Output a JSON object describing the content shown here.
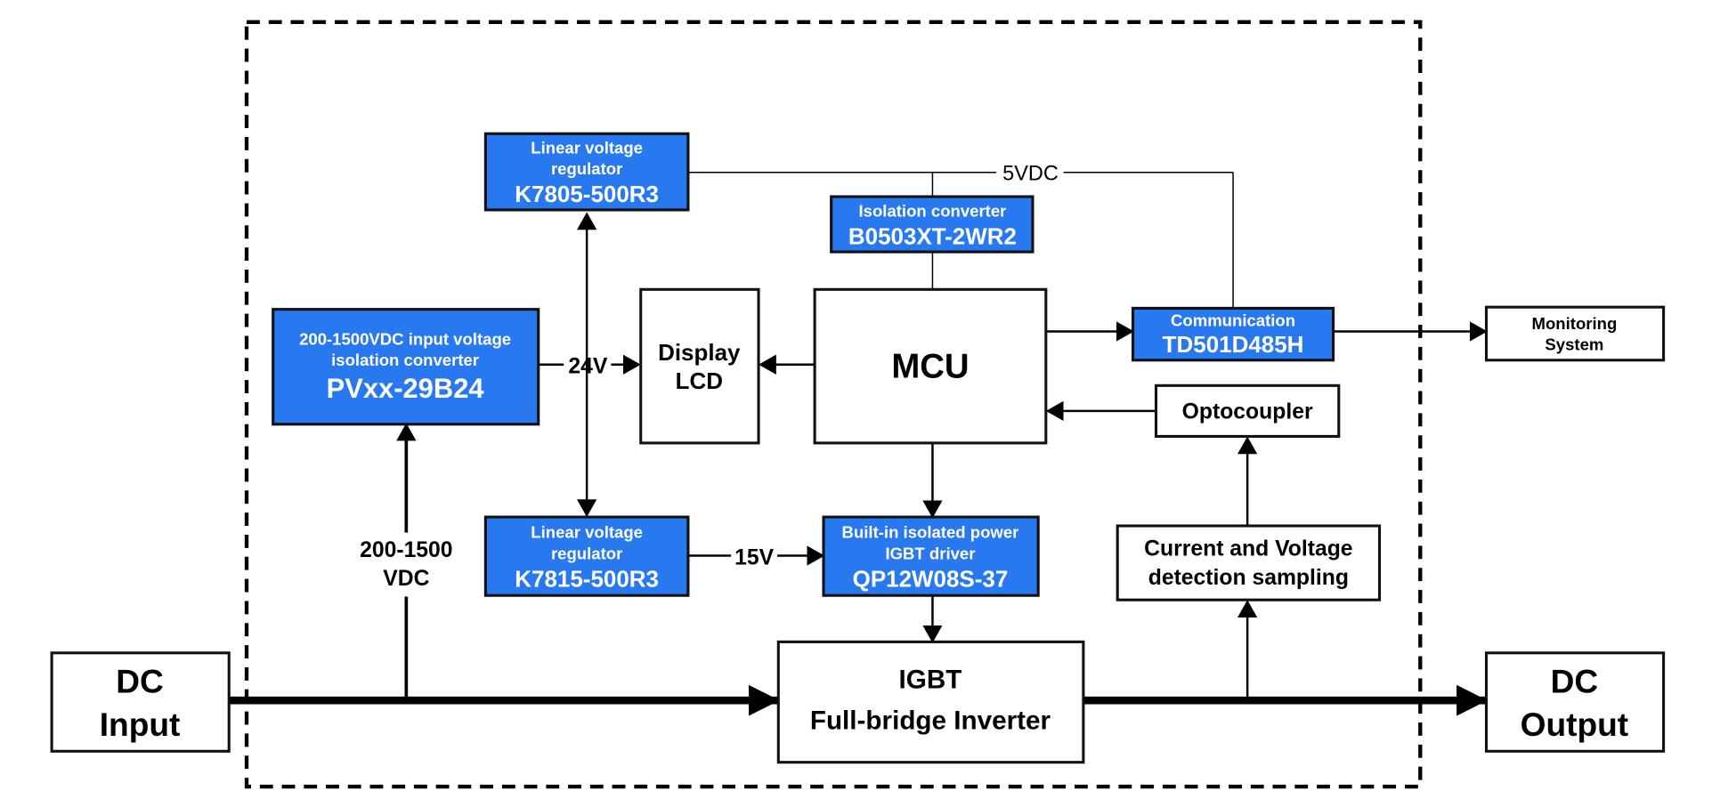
{
  "diagram": {
    "colors": {
      "module_fill": "#2878f0",
      "plain_fill": "#ffffff",
      "line": "#000000"
    },
    "external": {
      "dc_input": [
        "DC",
        "Input"
      ],
      "dc_output": [
        "DC",
        "Output"
      ],
      "monitoring": [
        "Monitoring",
        "System"
      ]
    },
    "modules": {
      "pv_converter": {
        "lines": [
          "200-1500VDC input voltage",
          "isolation converter"
        ],
        "model": "PVxx-29B24"
      },
      "ldo_5v": {
        "lines": [
          "Linear voltage",
          "regulator"
        ],
        "model": "K7805-500R3"
      },
      "ldo_15v": {
        "lines": [
          "Linear voltage",
          "regulator"
        ],
        "model": "K7815-500R3"
      },
      "isolation": {
        "lines": [
          "Isolation converter"
        ],
        "model": "B0503XT-2WR2"
      },
      "comm": {
        "lines": [
          "Communication"
        ],
        "model": "TD501D485H"
      },
      "igbt_driver": {
        "lines": [
          "Built-in isolated power",
          "IGBT driver"
        ],
        "model": "QP12W08S-37"
      }
    },
    "blocks": {
      "display": [
        "Display",
        "LCD"
      ],
      "mcu": "MCU",
      "optocoupler": "Optocoupler",
      "sampling": [
        "Current and Voltage",
        "detection sampling"
      ],
      "inverter": [
        "IGBT",
        "Full-bridge Inverter"
      ]
    },
    "labels": {
      "v24": "24V",
      "v15": "15V",
      "v5": "5VDC",
      "vin": [
        "200-1500",
        "VDC"
      ]
    }
  }
}
